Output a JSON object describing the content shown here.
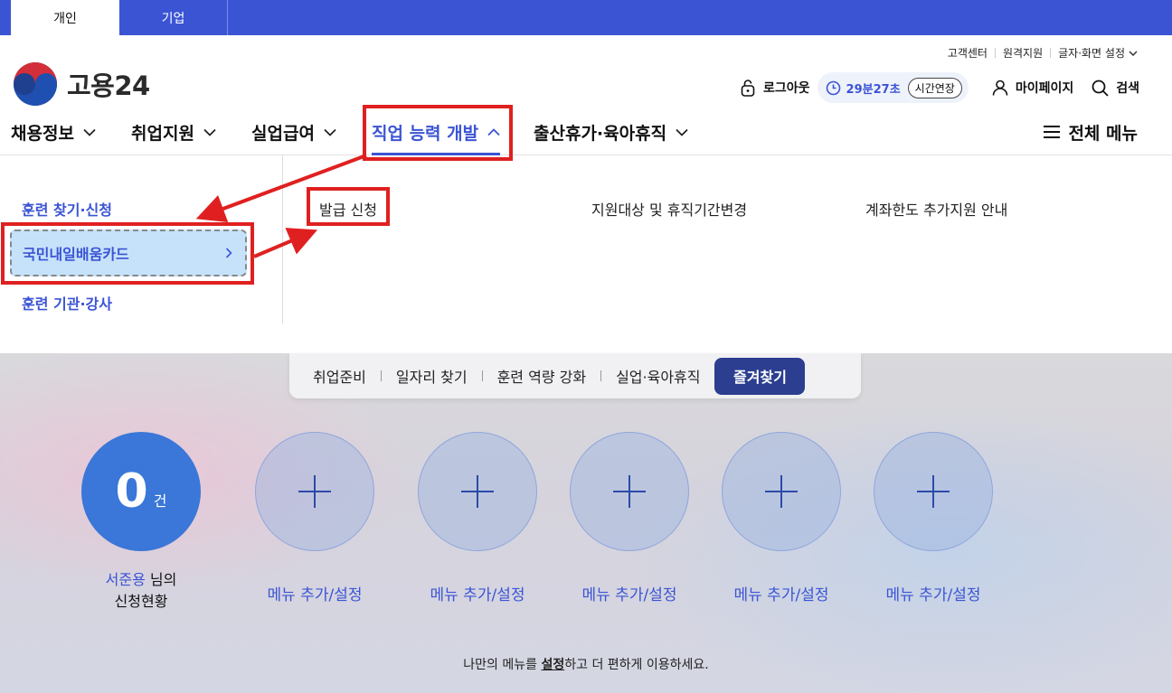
{
  "audience_tabs": [
    "개인",
    "기업"
  ],
  "utility_links": [
    "고객센터",
    "원격지원",
    "글자·화면 설정"
  ],
  "logo_text": "고용24",
  "header": {
    "logout": "로그아웃",
    "timer": "29분27초",
    "extend": "시간연장",
    "mypage": "마이페이지",
    "search": "검색"
  },
  "nav": {
    "items": [
      "채용정보",
      "취업지원",
      "실업급여",
      "직업 능력 개발",
      "출산휴가·육아휴직"
    ],
    "active_index": 3,
    "all_menu": "전체 메뉴"
  },
  "dropdown": {
    "left_items": [
      "훈련 찾기·신청",
      "국민내일배움카드",
      "훈련 기관·강사"
    ],
    "selected_index": 1,
    "sub_items": [
      "발급 신청",
      "지원대상 및 휴직기간변경",
      "계좌한도 추가지원 안내"
    ]
  },
  "quick_tabs": [
    "취업준비",
    "일자리 찾기",
    "훈련 역량 강화",
    "실업·육아휴직"
  ],
  "favorites": "즐겨찾기",
  "status": {
    "count": "0",
    "unit": "건",
    "name": "서준용",
    "suffix": " 님의",
    "label": "신청현황"
  },
  "menu_slot_label": "메뉴 추가/설정",
  "note": {
    "before": "나만의 메뉴를 ",
    "link": "설정",
    "after": "하고 더 편하게 이용하세요."
  },
  "colors": {
    "primary": "#3b54d4",
    "highlight": "#e02020",
    "selected_bg": "#c6e2fb",
    "favorites_bg": "#2c3e90"
  }
}
